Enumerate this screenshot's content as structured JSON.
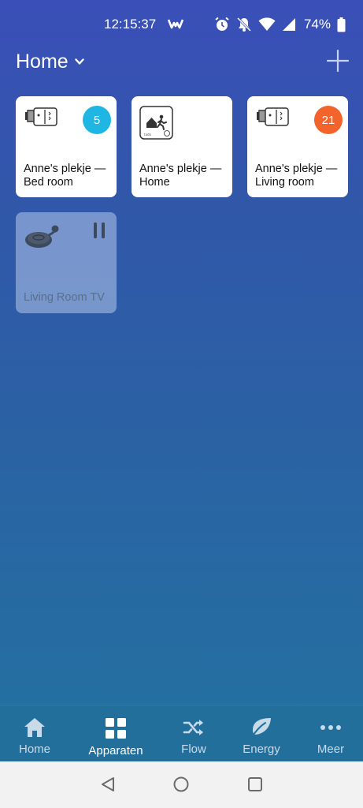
{
  "status_bar": {
    "time": "12:15:37",
    "battery": "74%",
    "icons": [
      "notification-app-icon",
      "alarm-icon",
      "mute-icon",
      "wifi-icon",
      "signal-icon",
      "battery-icon"
    ]
  },
  "header": {
    "title": "Home",
    "dropdown_icon": "chevron-down-icon",
    "add_icon": "plus-icon"
  },
  "devices": [
    {
      "label": "Anne's plekje — Bed room",
      "icon": "thermostat-valve-icon",
      "badge": "5",
      "badge_color": "#1fb6e4",
      "active": true
    },
    {
      "label": "Anne's plekje — Home",
      "icon": "away-mode-icon",
      "badge": "",
      "active": true
    },
    {
      "label": "Anne's plekje — Living room",
      "icon": "thermostat-valve-icon",
      "badge": "21",
      "badge_color": "#f2642b",
      "active": true
    },
    {
      "label": "Living Room TV",
      "icon": "chromecast-icon",
      "status_icon": "pause-icon",
      "active": false
    }
  ],
  "bottom_nav": [
    {
      "label": "Home",
      "icon": "house-icon",
      "active": false
    },
    {
      "label": "Apparaten",
      "icon": "grid-icon",
      "active": true
    },
    {
      "label": "Flow",
      "icon": "shuffle-icon",
      "active": false
    },
    {
      "label": "Energy",
      "icon": "leaf-icon",
      "active": false
    },
    {
      "label": "Meer",
      "icon": "more-dots-icon",
      "active": false
    }
  ],
  "system_nav": [
    "back-icon",
    "home-circle-icon",
    "recents-icon"
  ],
  "colors": {
    "background_top": "#3a4fb8",
    "background_bottom": "#2275a0",
    "tile": "#ffffff",
    "badge_blue": "#1fb6e4",
    "badge_orange": "#f2642b"
  }
}
